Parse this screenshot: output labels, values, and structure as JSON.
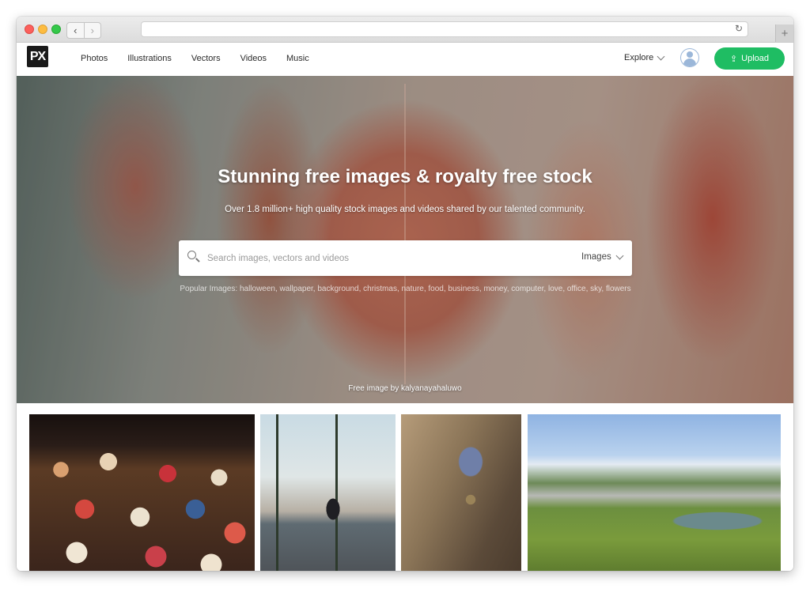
{
  "nav": {
    "logo": "PX",
    "links": [
      "Photos",
      "Illustrations",
      "Vectors",
      "Videos",
      "Music"
    ],
    "explore": "Explore",
    "upload": "Upload"
  },
  "hero": {
    "title": "Stunning free images & royalty free stock",
    "subtitle": "Over 1.8 million+ high quality stock images and videos shared by our talented community.",
    "search_placeholder": "Search images, vectors and videos",
    "search_type": "Images",
    "popular": "Popular Images: halloween, wallpaper, background, christmas, nature, food, business, money, computer, love, office, sky, flowers",
    "credit": "Free image by kalyanayahaluwo"
  },
  "colors": {
    "upload_green": "#1fbd63",
    "logo_bg": "#1a1a1a"
  }
}
